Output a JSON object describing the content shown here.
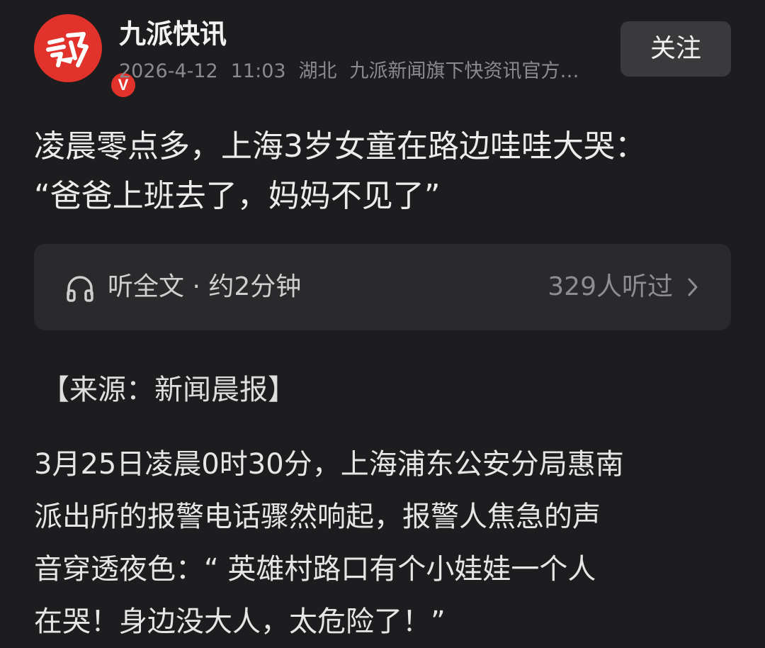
{
  "header": {
    "account_name": "九派快讯",
    "verified_badge": "V",
    "date": "2026-4-12",
    "time": "11:03",
    "location": "湖北",
    "description": "九派新闻旗下快资讯官方…",
    "follow_label": "关注",
    "avatar_color": "#e2322c"
  },
  "article": {
    "title": "凌晨零点多，上海3岁女童在路边哇哇大哭：\n“爸爸上班去了，妈妈不见了”",
    "source": "【来源：新闻晨报】",
    "paragraph": "3月25日凌晨0时30分，上海浦东公安分局惠南\n派出所的报警电话骤然响起，报警人焦急的声\n音穿透夜色：“ 英雄村路口有个小娃娃一个人\n在哭！身边没大人，太危险了！”"
  },
  "listen": {
    "label": "听全文 · 约2分钟",
    "count": "329人听过",
    "icon": "headphone-icon"
  }
}
